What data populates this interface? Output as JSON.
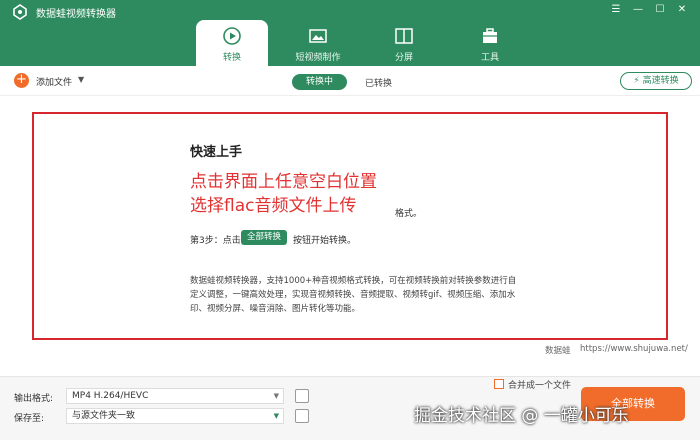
{
  "app": {
    "title": "数据蛙视频转换器"
  },
  "window": {
    "minimize": "—",
    "maximize": "☐",
    "close": "✕"
  },
  "tabs": [
    {
      "label": "转换",
      "icon": "convert-icon"
    },
    {
      "label": "短视频制作",
      "icon": "image-icon"
    },
    {
      "label": "分屏",
      "icon": "split-screen-icon"
    },
    {
      "label": "工具",
      "icon": "toolbox-icon"
    }
  ],
  "toolbar": {
    "add_file": "添加文件",
    "status_converting": "转换中",
    "status_done": "已转换",
    "fast_convert": "高速转换"
  },
  "main": {
    "quick_start_title": "快速上手",
    "annotation_line1": "点击界面上任意空白位置",
    "annotation_line2": "选择flac音频文件上传",
    "step2_tail": "格式。",
    "step3_prefix": "第3步：点击",
    "step3_button": "全部转换",
    "step3_suffix": "按钮开始转换。",
    "description": "数据蛙视频转换器，支持1000+种音视频格式转换，可在视频转换前对转换参数进行自定义调整，一键高效处理，实现音视频转换、音频提取、视频转gif、视频压缩、添加水印、视频分屏、噪音消除、图片转化等功能。",
    "brand": "数据蛙",
    "brand_url": "https://www.shujuwa.net/"
  },
  "bottom": {
    "output_format_label": "输出格式:",
    "output_format_value": "MP4 H.264/HEVC",
    "save_to_label": "保存至:",
    "save_to_value": "与源文件夹一致",
    "merge_label": "合并成一个文件",
    "convert_all": "全部转换"
  },
  "watermark": "掘金技术社区 @ 一罐小可乐",
  "colors": {
    "brand_green": "#2e8b5f",
    "accent_orange": "#f16c2a",
    "annotation_red": "#d6262e"
  }
}
